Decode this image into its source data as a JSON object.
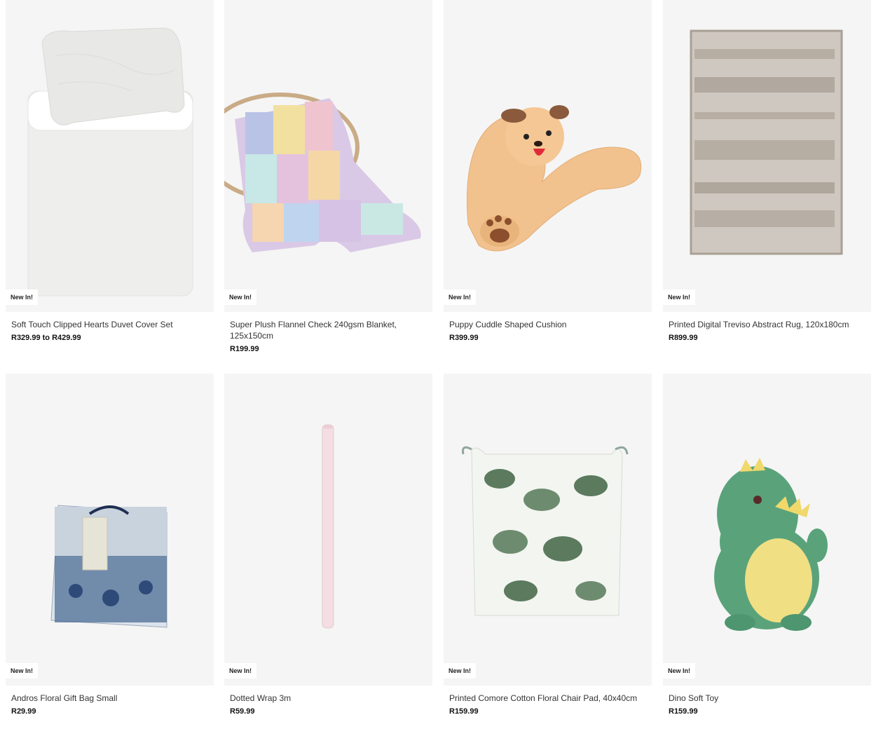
{
  "products": [
    {
      "badge": "New In!",
      "title": "Soft Touch Clipped Hearts Duvet Cover Set",
      "price": "R329.99 to R429.99",
      "icon": "duvet-image"
    },
    {
      "badge": "New In!",
      "title": "Super Plush Flannel Check 240gsm Blanket, 125x150cm",
      "price": "R199.99",
      "icon": "blanket-image"
    },
    {
      "badge": "New In!",
      "title": "Puppy Cuddle Shaped Cushion",
      "price": "R399.99",
      "icon": "cushion-image"
    },
    {
      "badge": "New In!",
      "title": "Printed Digital Treviso Abstract Rug, 120x180cm",
      "price": "R899.99",
      "icon": "rug-image"
    },
    {
      "badge": "New In!",
      "title": "Andros Floral Gift Bag Small",
      "price": "R29.99",
      "icon": "gift-bag-image"
    },
    {
      "badge": "New In!",
      "title": "Dotted Wrap 3m",
      "price": "R59.99",
      "icon": "wrap-roll-image"
    },
    {
      "badge": "New In!",
      "title": "Printed Comore Cotton Floral Chair Pad, 40x40cm",
      "price": "R159.99",
      "icon": "chair-pad-image"
    },
    {
      "badge": "New In!",
      "title": "Dino Soft Toy",
      "price": "R159.99",
      "icon": "soft-toy-image"
    }
  ]
}
